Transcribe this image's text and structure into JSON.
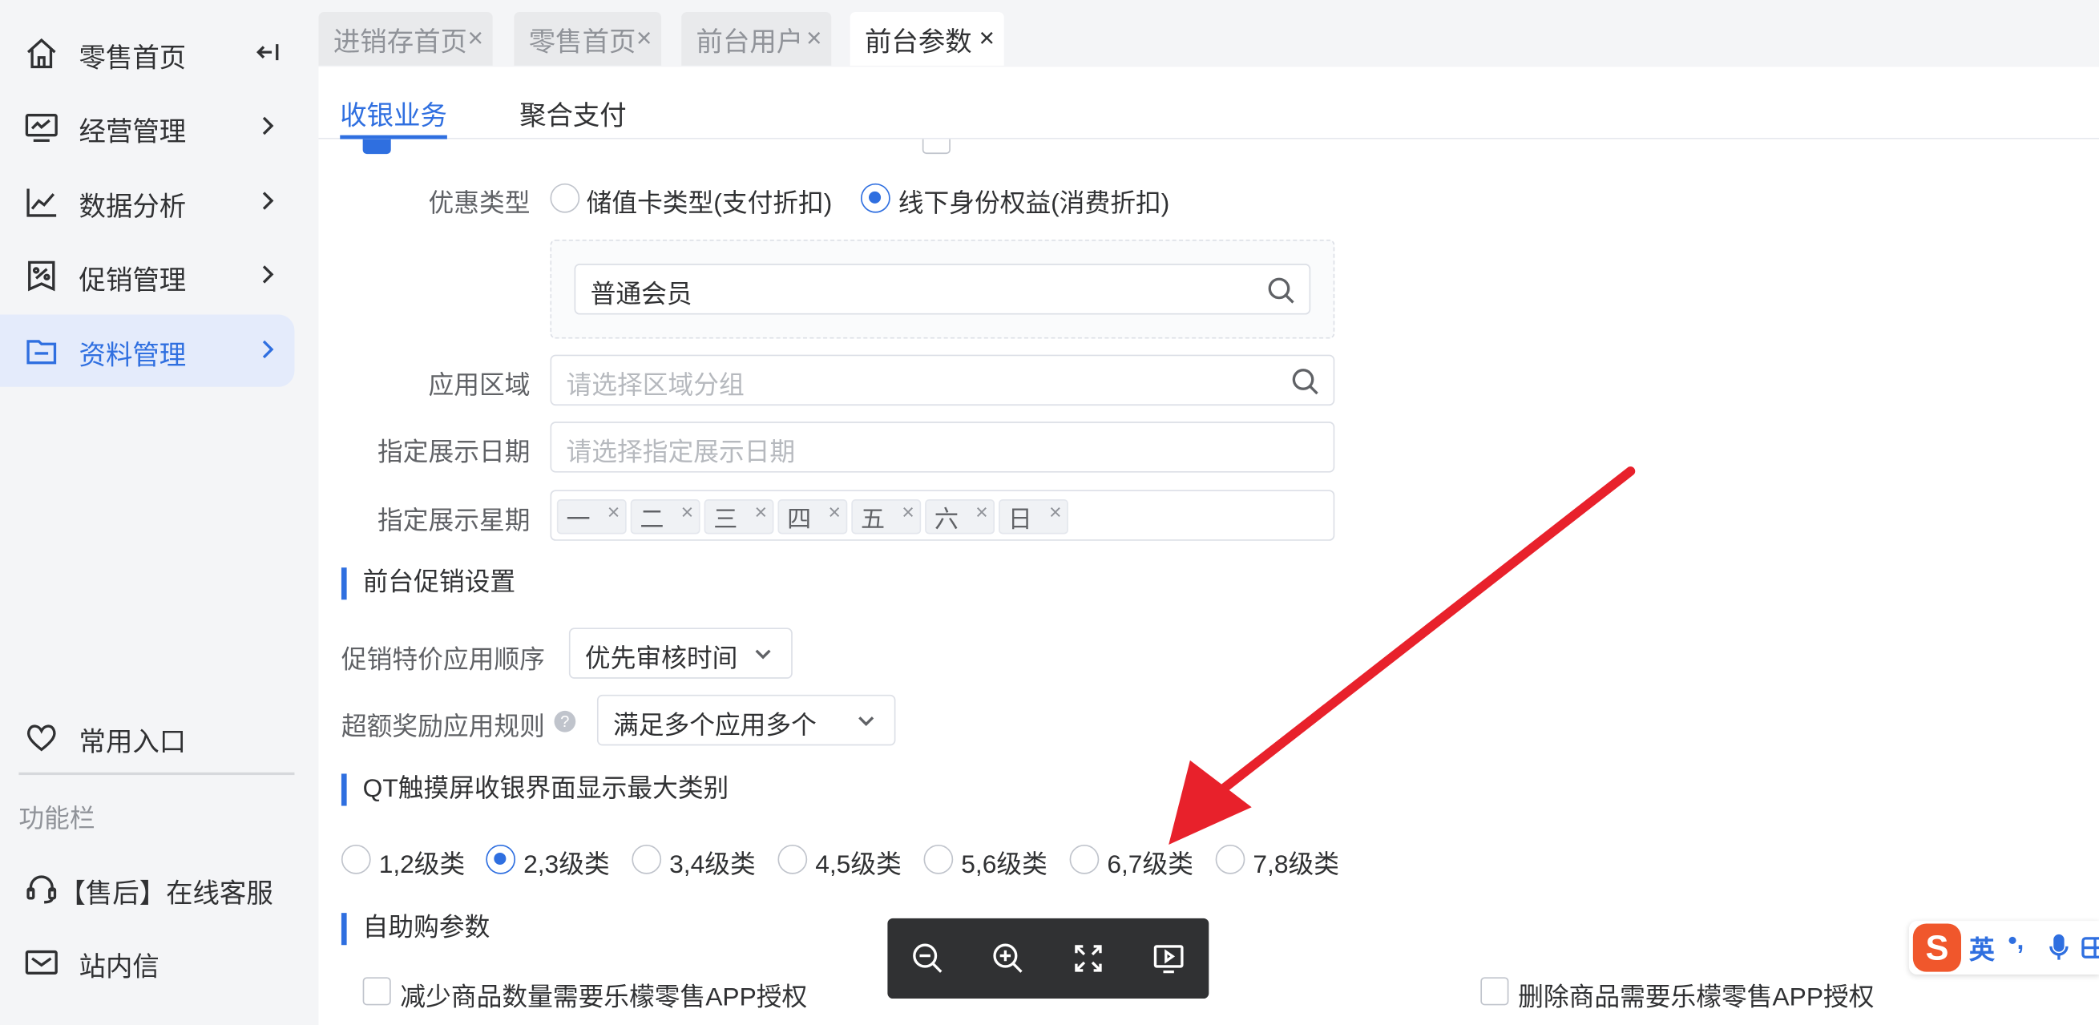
{
  "sidebar": {
    "items": [
      {
        "label": "零售首页",
        "icon": "home-icon"
      },
      {
        "label": "经营管理",
        "icon": "monitor-icon"
      },
      {
        "label": "数据分析",
        "icon": "line-chart-icon"
      },
      {
        "label": "促销管理",
        "icon": "promotion-icon"
      },
      {
        "label": "资料管理",
        "icon": "folder-icon"
      }
    ],
    "bottom": [
      {
        "label": "常用入口",
        "icon": "heart-icon"
      },
      {
        "label": "【售后】在线客服",
        "icon": "headset-icon"
      },
      {
        "label": "站内信",
        "icon": "mail-icon"
      }
    ],
    "section_label": "功能栏",
    "active_color": "#2f6fe0"
  },
  "tabs": [
    {
      "label": "进销存首页"
    },
    {
      "label": "零售首页"
    },
    {
      "label": "前台用户"
    },
    {
      "label": "前台参数"
    }
  ],
  "subtabs": [
    {
      "label": "收银业务"
    },
    {
      "label": "聚合支付"
    }
  ],
  "form": {
    "discount_type": {
      "label": "优惠类型",
      "options": [
        "储值卡类型(支付折扣)",
        "线下身份权益(消费折扣)"
      ],
      "selected": "线下身份权益(消费折扣)"
    },
    "member_level_value": "普通会员",
    "region": {
      "label": "应用区域",
      "placeholder": "请选择区域分组"
    },
    "date": {
      "label": "指定展示日期",
      "placeholder": "请选择指定展示日期"
    },
    "weekday": {
      "label": "指定展示星期",
      "tags": [
        "一",
        "二",
        "三",
        "四",
        "五",
        "六",
        "日"
      ]
    }
  },
  "promo_section": {
    "title": "前台促销设置",
    "price_order": {
      "label": "促销特价应用顺序",
      "value": "优先审核时间"
    },
    "over_reward": {
      "label": "超额奖励应用规则",
      "value": "满足多个应用多个"
    }
  },
  "qt_section": {
    "title": "QT触摸屏收银界面显示最大类别",
    "options": [
      "1,2级类",
      "2,3级类",
      "3,4级类",
      "4,5级类",
      "5,6级类",
      "6,7级类",
      "7,8级类"
    ],
    "selected": "2,3级类"
  },
  "self_service_section": {
    "title": "自助购参数",
    "checkbox_left": "减少商品数量需要乐檬零售APP授权",
    "checkbox_right": "删除商品需要乐檬零售APP授权"
  },
  "ime": {
    "logo": "S",
    "lang": "英",
    "punc": "•,"
  },
  "arrow_color": "#e8212b"
}
